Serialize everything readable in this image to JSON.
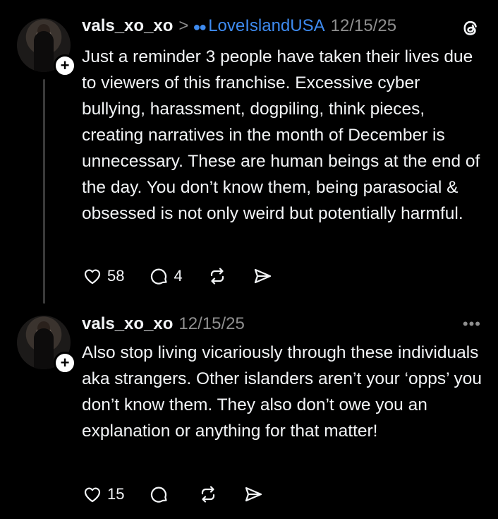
{
  "posts": [
    {
      "username": "vals_xo_xo",
      "topic_separator": ">",
      "topic": "LoveIslandUSA",
      "date": "12/15/25",
      "text": "Just a reminder 3 people have taken their lives due to viewers of this franchise. Excessive cyber bullying, harassment, dogpiling, think pieces, creating narratives in the month of December is unnecessary. These are human beings at the end of the day. You don’t know them, being parasocial & obsessed is not only weird but potentially harmful.",
      "likes": "58",
      "replies": "4"
    },
    {
      "username": "vals_xo_xo",
      "date": "12/15/25",
      "text": "Also stop living vicariously through these individuals aka strangers. Other islanders aren’t your ‘opps’ you don’t know them. They also don’t owe you an explanation or anything for that matter!",
      "likes": "15",
      "replies": ""
    }
  ],
  "icons": {
    "follow": "+",
    "more": "•••",
    "brand": "threads-logo-icon",
    "like": "heart-icon",
    "reply": "comment-icon",
    "repost": "repost-icon",
    "share": "send-icon"
  },
  "colors": {
    "background": "#000000",
    "text": "#f3f5f7",
    "muted": "#8f8f8f",
    "topic": "#3e8bf0"
  }
}
